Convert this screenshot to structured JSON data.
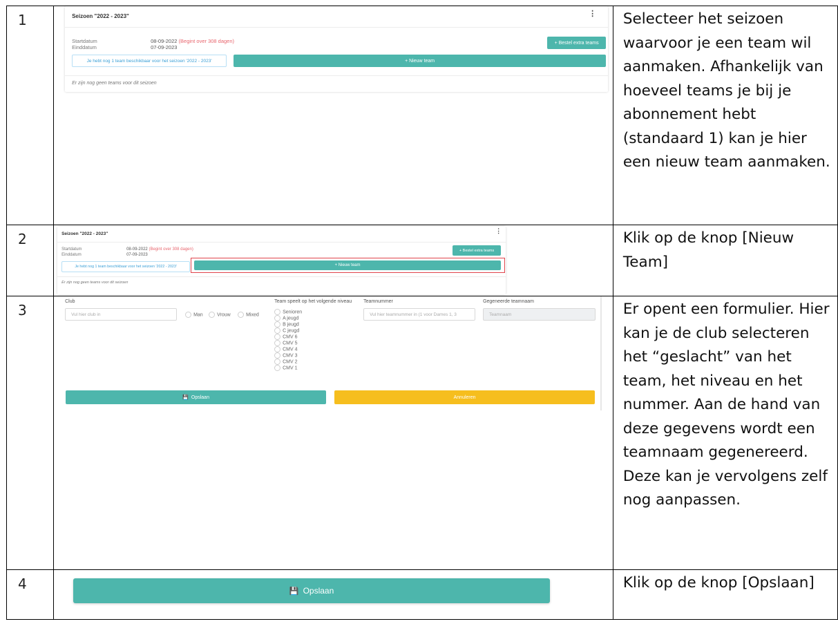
{
  "rows": [
    {
      "number": "1",
      "description": "Selecteer het seizoen waarvoor je een team wil aanmaken. Afhankelijk van hoeveel teams je bij je abonnement hebt (standaard 1) kan je hier een nieuw team aanmaken."
    },
    {
      "number": "2",
      "description": "Klik op de knop [Nieuw Team]"
    },
    {
      "number": "3",
      "description": "Er opent een formulier. Hier kan je de club selecteren het “geslacht” van het team, het niveau en het nummer. Aan de hand van deze gegevens wordt een teamnaam gegenereerd. Deze kan je vervolgens zelf nog aanpassen."
    },
    {
      "number": "4",
      "description": "Klik op de knop [Opslaan]"
    }
  ],
  "season_card": {
    "title": "Seizoen \"2022 - 2023\"",
    "menu_icon": "kebab-menu-icon",
    "start_label": "Startdatum",
    "start_value": "08-09-2022",
    "start_note": "(Begint over 308 dagen)",
    "end_label": "Einddatum",
    "end_value": "07-09-2023",
    "order_button": "+ Bestel extra teams",
    "info_text": "Je hebt nog 1 team beschikbaar voor het seizoen '2022 - 2023'",
    "new_team_button": "+ Nieuw team",
    "empty_text": "Er zijn nog geen teams voor dit seizoen"
  },
  "form": {
    "club_label": "Club",
    "club_placeholder": "Vul hier club in",
    "gender_options": [
      "Man",
      "Vrouw",
      "Mixed"
    ],
    "level_label": "Team speelt op het volgende niveau",
    "levels": [
      "Senioren",
      "A jeugd",
      "B jeugd",
      "C jeugd",
      "CMV 6",
      "CMV 5",
      "CMV 4",
      "CMV 3",
      "CMV 2",
      "CMV 1"
    ],
    "number_label": "Teamnummer",
    "number_placeholder": "Vul hier teamnummer in (1 voor Dames 1, 3",
    "name_label": "Gegeneerde teamnaam",
    "name_placeholder": "Teamnaam",
    "save_button": "Opslaan",
    "cancel_button": "Annuleren"
  },
  "save_big_button": "Opslaan",
  "colors": {
    "teal": "#4db6ac",
    "yellow": "#f6be1e",
    "red_note": "#e8666e",
    "highlight_border": "#e0434b"
  }
}
